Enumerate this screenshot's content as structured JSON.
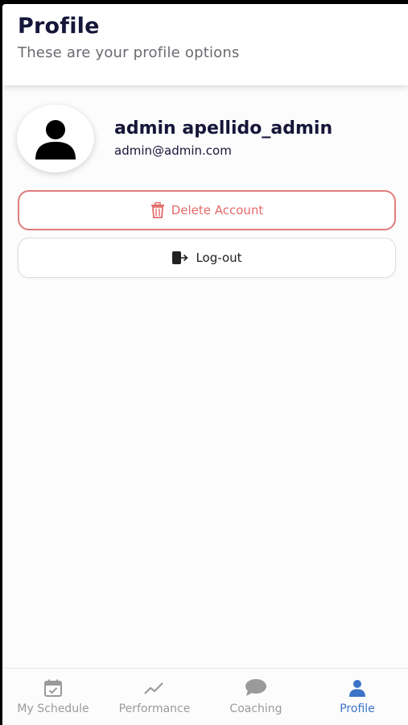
{
  "header": {
    "title": "Profile",
    "subtitle": "These are your profile options"
  },
  "user": {
    "avatar_icon": "person-icon",
    "name": "admin apellido_admin",
    "email": "admin@admin.com"
  },
  "actions": {
    "delete": {
      "label": "Delete Account",
      "icon": "trash-icon",
      "color": "#e46a6a"
    },
    "logout": {
      "label": "Log-out",
      "icon": "logout-icon"
    }
  },
  "tabs": [
    {
      "label": "My Schedule",
      "icon": "calendar-check-icon",
      "active": false
    },
    {
      "label": "Performance",
      "icon": "trend-line-icon",
      "active": false
    },
    {
      "label": "Coaching",
      "icon": "chat-bubble-icon",
      "active": false
    },
    {
      "label": "Profile",
      "icon": "person-icon",
      "active": true
    }
  ],
  "colors": {
    "accent": "#3b73c8",
    "title": "#16163a",
    "danger": "#e46a6a",
    "inactive_tab": "#9a9a9a"
  }
}
